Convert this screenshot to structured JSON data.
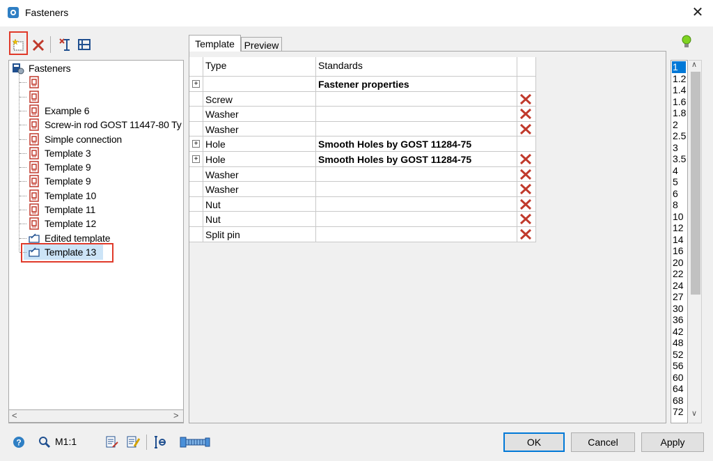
{
  "window": {
    "title": "Fasteners",
    "close": "✕"
  },
  "toolbar": {
    "icons": [
      "new-template-icon",
      "delete-icon",
      "insert-icon",
      "edit-icon"
    ]
  },
  "tree": {
    "root": "Fasteners",
    "items": [
      {
        "label": "",
        "icon": "template-icon"
      },
      {
        "label": "",
        "icon": "template-icon"
      },
      {
        "label": "Example 6",
        "icon": "template-icon"
      },
      {
        "label": "Screw-in rod GOST 11447-80 Ty",
        "icon": "template-icon"
      },
      {
        "label": "Simple connection",
        "icon": "template-icon"
      },
      {
        "label": "Template 3",
        "icon": "template-icon"
      },
      {
        "label": "Template 9",
        "icon": "template-icon"
      },
      {
        "label": "Template 9",
        "icon": "template-icon"
      },
      {
        "label": "Template 10",
        "icon": "template-icon"
      },
      {
        "label": "Template 11",
        "icon": "template-icon"
      },
      {
        "label": "Template 12",
        "icon": "template-icon"
      },
      {
        "label": "Edited template",
        "icon": "edited-template-icon"
      },
      {
        "label": "Template 13",
        "icon": "edited-template-icon",
        "selected": true
      }
    ]
  },
  "tabs": [
    {
      "label": "Template",
      "active": true
    },
    {
      "label": "Preview",
      "active": false
    }
  ],
  "grid": {
    "headers": {
      "type": "Type",
      "standards": "Standards"
    },
    "rows": [
      {
        "expander": true,
        "type": "",
        "standard": "Fastener properties",
        "bold": true,
        "delete": false
      },
      {
        "expander": false,
        "type": "Screw",
        "standard": "",
        "bold": false,
        "delete": true
      },
      {
        "expander": false,
        "type": "Washer",
        "standard": "",
        "bold": false,
        "delete": true
      },
      {
        "expander": false,
        "type": "Washer",
        "standard": "",
        "bold": false,
        "delete": true
      },
      {
        "expander": true,
        "type": "Hole",
        "standard": "Smooth Holes by GOST 11284-75",
        "bold": true,
        "delete": false
      },
      {
        "expander": true,
        "type": "Hole",
        "standard": "Smooth Holes by GOST 11284-75",
        "bold": true,
        "delete": true
      },
      {
        "expander": false,
        "type": "Washer",
        "standard": "",
        "bold": false,
        "delete": true
      },
      {
        "expander": false,
        "type": "Washer",
        "standard": "",
        "bold": false,
        "delete": true
      },
      {
        "expander": false,
        "type": "Nut",
        "standard": "",
        "bold": false,
        "delete": true
      },
      {
        "expander": false,
        "type": "Nut",
        "standard": "",
        "bold": false,
        "delete": true
      },
      {
        "expander": false,
        "type": "Split pin",
        "standard": "",
        "bold": false,
        "delete": true
      }
    ]
  },
  "sizes": {
    "selected": "1",
    "items": [
      "1",
      "1.2",
      "1.4",
      "1.6",
      "1.8",
      "2",
      "2.5",
      "3",
      "3.5",
      "4",
      "5",
      "6",
      "8",
      "10",
      "12",
      "14",
      "16",
      "20",
      "22",
      "24",
      "27",
      "30",
      "36",
      "42",
      "48",
      "52",
      "56",
      "60",
      "64",
      "68",
      "72"
    ]
  },
  "bottom": {
    "scale": "M1:1",
    "ok": "OK",
    "cancel": "Cancel",
    "apply": "Apply"
  },
  "colors": {
    "highlight": "#e03a2a",
    "delete": "#c0392b",
    "selection": "#0078d7"
  }
}
